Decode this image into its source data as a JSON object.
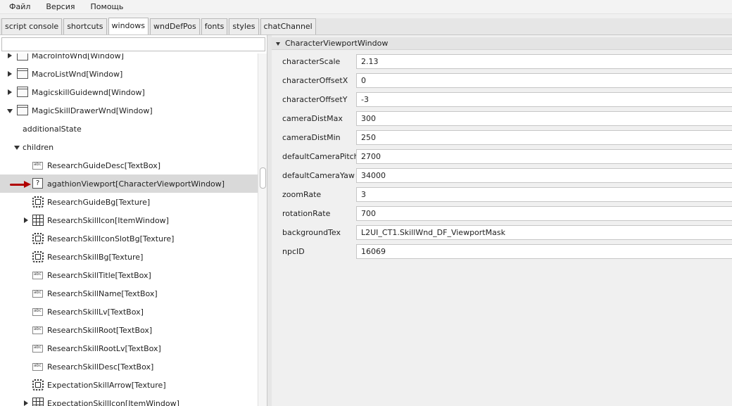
{
  "menu": [
    "Файл",
    "Версия",
    "Помощь"
  ],
  "tabs": [
    {
      "label": "script console",
      "active": false
    },
    {
      "label": "shortcuts",
      "active": false
    },
    {
      "label": "windows",
      "active": true
    },
    {
      "label": "wndDefPos",
      "active": false
    },
    {
      "label": "fonts",
      "active": false
    },
    {
      "label": "styles",
      "active": false
    },
    {
      "label": "chatChannel",
      "active": false
    }
  ],
  "tree": {
    "filter_value": "",
    "rows": [
      {
        "label": "MacroInfoWnd[Window]",
        "icon": "window-icon",
        "arrow": "right"
      },
      {
        "label": "MacroListWnd[Window]",
        "icon": "window-icon",
        "arrow": "right"
      },
      {
        "label": "MagicskillGuidewnd[Window]",
        "icon": "window-icon",
        "arrow": "right"
      },
      {
        "label": "MagicSkillDrawerWnd[Window]",
        "icon": "window-icon",
        "arrow": "down"
      },
      {
        "label": "additionalState",
        "icon": "",
        "arrow": ""
      },
      {
        "label": "children",
        "icon": "",
        "arrow": "down"
      },
      {
        "label": "ResearchGuideDesc[TextBox]",
        "icon": "textbox-icon",
        "arrow": ""
      },
      {
        "label": "agathionViewport[CharacterViewportWindow]",
        "icon": "unknown-icon",
        "arrow": "",
        "selected": true
      },
      {
        "label": "ResearchGuideBg[Texture]",
        "icon": "texture-icon",
        "arrow": ""
      },
      {
        "label": "ResearchSkillIcon[ItemWindow]",
        "icon": "itemwindow-icon",
        "arrow": "right"
      },
      {
        "label": "ResearchSkillIconSlotBg[Texture]",
        "icon": "texture-icon",
        "arrow": ""
      },
      {
        "label": "ResearchSkillBg[Texture]",
        "icon": "texture-icon",
        "arrow": ""
      },
      {
        "label": "ResearchSkillTitle[TextBox]",
        "icon": "textbox-icon",
        "arrow": ""
      },
      {
        "label": "ResearchSkillName[TextBox]",
        "icon": "textbox-icon",
        "arrow": ""
      },
      {
        "label": "ResearchSkillLv[TextBox]",
        "icon": "textbox-icon",
        "arrow": ""
      },
      {
        "label": "ResearchSkillRoot[TextBox]",
        "icon": "textbox-icon",
        "arrow": ""
      },
      {
        "label": "ResearchSkillRootLv[TextBox]",
        "icon": "textbox-icon",
        "arrow": ""
      },
      {
        "label": "ResearchSkillDesc[TextBox]",
        "icon": "textbox-icon",
        "arrow": ""
      },
      {
        "label": "ExpectationSkillArrow[Texture]",
        "icon": "texture-icon",
        "arrow": ""
      },
      {
        "label": "ExpectationSkillIcon[ItemWindow]",
        "icon": "itemwindow-icon",
        "arrow": "right"
      }
    ]
  },
  "properties": {
    "group_title": "CharacterViewportWindow",
    "items": [
      {
        "name": "characterScale",
        "value": "2.13"
      },
      {
        "name": "characterOffsetX",
        "value": "0"
      },
      {
        "name": "characterOffsetY",
        "value": "-3"
      },
      {
        "name": "cameraDistMax",
        "value": "300"
      },
      {
        "name": "cameraDistMin",
        "value": "250"
      },
      {
        "name": "defaultCameraPitch",
        "value": "2700"
      },
      {
        "name": "defaultCameraYaw",
        "value": "34000"
      },
      {
        "name": "zoomRate",
        "value": "3"
      },
      {
        "name": "rotationRate",
        "value": "700"
      },
      {
        "name": "backgroundTex",
        "value": "L2UI_CT1.SkillWnd_DF_ViewportMask"
      },
      {
        "name": "npcID",
        "value": "16069"
      }
    ]
  }
}
